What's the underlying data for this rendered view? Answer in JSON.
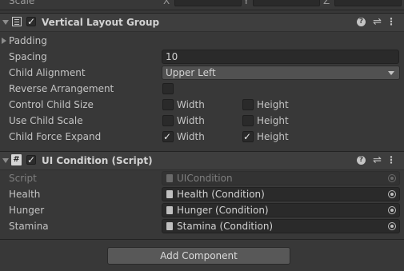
{
  "top_strip": {
    "label": "Scale",
    "axes": [
      "X",
      "Y",
      "Z"
    ]
  },
  "vertical_layout_group": {
    "title": "Vertical Layout Group",
    "enabled": true,
    "padding_label": "Padding",
    "spacing_label": "Spacing",
    "spacing_value": "10",
    "child_alignment_label": "Child Alignment",
    "child_alignment_value": "Upper Left",
    "reverse_arrangement_label": "Reverse Arrangement",
    "control_child_size_label": "Control Child Size",
    "use_child_scale_label": "Use Child Scale",
    "child_force_expand_label": "Child Force Expand",
    "width_label": "Width",
    "height_label": "Height",
    "reverse_arrangement": false,
    "control_child_size": {
      "width": false,
      "height": false
    },
    "use_child_scale": {
      "width": false,
      "height": false
    },
    "child_force_expand": {
      "width": true,
      "height": true
    }
  },
  "ui_condition": {
    "title": "UI Condition (Script)",
    "enabled": true,
    "script_label": "Script",
    "script_value": "UICondition",
    "fields": [
      {
        "label": "Health",
        "value": "Health (Condition)"
      },
      {
        "label": "Hunger",
        "value": "Hunger (Condition)"
      },
      {
        "label": "Stamina",
        "value": "Stamina (Condition)"
      }
    ]
  },
  "header_icons": {
    "help": "?",
    "preset": "⇌",
    "menu": "⋮"
  },
  "add_component_label": "Add Component"
}
